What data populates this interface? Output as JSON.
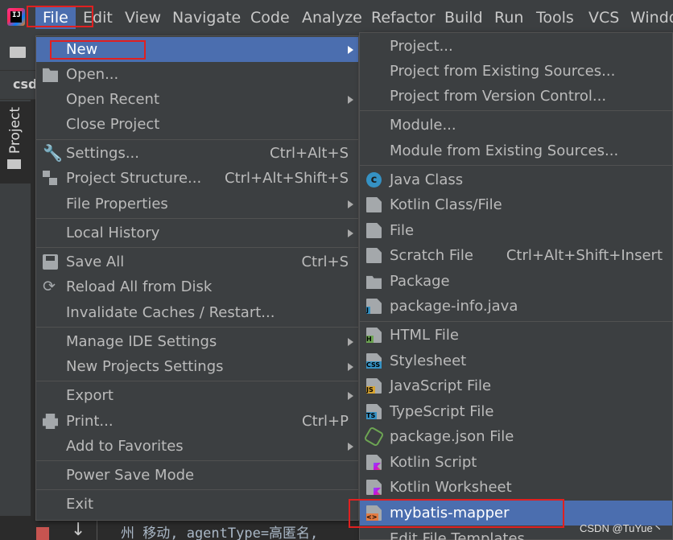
{
  "menubar": {
    "items": [
      "File",
      "Edit",
      "View",
      "Navigate",
      "Code",
      "Analyze",
      "Refactor",
      "Build",
      "Run",
      "Tools",
      "VCS",
      "Windo"
    ]
  },
  "background": {
    "tab_label": "csd",
    "tool_window": "Project",
    "code_line": "州 移动, agentType=高匿名,",
    "watermark": "CSDN @TuYue丶"
  },
  "file_menu": {
    "items": [
      {
        "label": "New",
        "submenu": true,
        "selected": true
      },
      {
        "label": "Open..."
      },
      {
        "label": "Open Recent",
        "submenu": true
      },
      {
        "label": "Close Project"
      },
      {
        "label": "Settings...",
        "shortcut": "Ctrl+Alt+S"
      },
      {
        "label": "Project Structure...",
        "shortcut": "Ctrl+Alt+Shift+S"
      },
      {
        "label": "File Properties",
        "submenu": true
      },
      {
        "label": "Local History",
        "submenu": true
      },
      {
        "label": "Save All",
        "shortcut": "Ctrl+S"
      },
      {
        "label": "Reload All from Disk"
      },
      {
        "label": "Invalidate Caches / Restart..."
      },
      {
        "label": "Manage IDE Settings",
        "submenu": true
      },
      {
        "label": "New Projects Settings",
        "submenu": true
      },
      {
        "label": "Export",
        "submenu": true
      },
      {
        "label": "Print...",
        "shortcut": "Ctrl+P"
      },
      {
        "label": "Add to Favorites",
        "submenu": true
      },
      {
        "label": "Power Save Mode"
      },
      {
        "label": "Exit"
      }
    ]
  },
  "new_submenu": {
    "items": [
      {
        "label": "Project..."
      },
      {
        "label": "Project from Existing Sources..."
      },
      {
        "label": "Project from Version Control..."
      },
      {
        "label": "Module..."
      },
      {
        "label": "Module from Existing Sources..."
      },
      {
        "label": "Java Class",
        "icon": "java-class-icon"
      },
      {
        "label": "Kotlin Class/File",
        "icon": "kotlin-file-icon"
      },
      {
        "label": "File",
        "icon": "file-icon"
      },
      {
        "label": "Scratch File",
        "shortcut": "Ctrl+Alt+Shift+Insert",
        "icon": "scratch-file-icon"
      },
      {
        "label": "Package",
        "icon": "package-icon"
      },
      {
        "label": "package-info.java",
        "icon": "java-file-icon"
      },
      {
        "label": "HTML File",
        "icon": "html-file-icon",
        "tag": "H"
      },
      {
        "label": "Stylesheet",
        "icon": "css-file-icon",
        "tag": "CSS"
      },
      {
        "label": "JavaScript File",
        "icon": "js-file-icon",
        "tag": "JS"
      },
      {
        "label": "TypeScript File",
        "icon": "ts-file-icon",
        "tag": "TS"
      },
      {
        "label": "package.json File",
        "icon": "nodejs-icon"
      },
      {
        "label": "Kotlin Script",
        "icon": "kotlin-script-icon"
      },
      {
        "label": "Kotlin Worksheet",
        "icon": "kotlin-worksheet-icon"
      },
      {
        "label": "mybatis-mapper",
        "selected": true,
        "icon": "mybatis-mapper-icon"
      },
      {
        "label": "Edit File Templates..."
      }
    ]
  },
  "colors": {
    "background": "#3c3f41",
    "selection": "#4b6eaf",
    "separator": "#515151",
    "highlight_box": "#e02020",
    "java_class": "#3592c4",
    "html_tag": "#6da553",
    "css_tag": "#3592c4",
    "js_tag": "#d7a430",
    "ts_tag": "#3592c4",
    "xml_tag": "#e47c43"
  }
}
